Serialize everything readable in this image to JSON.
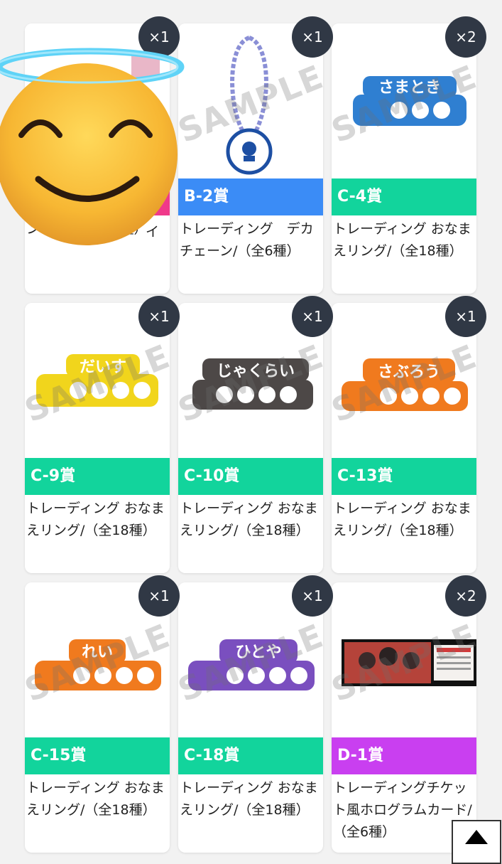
{
  "cards": [
    {
      "grade": "",
      "grade_color": "#f0398a",
      "quantity": "×1",
      "description": "ンボード/（全6種）",
      "obscured_title_fragment": "イ",
      "image": "pink-item-obscured"
    },
    {
      "grade": "B-2賞",
      "grade_color": "#3b8cf6",
      "quantity": "×1",
      "description": "トレーディング　デカチェーン/（全6種）",
      "image": "chain-skull-keyholder"
    },
    {
      "grade": "C-4賞",
      "grade_color": "#12d49c",
      "quantity": "×2",
      "description": "トレーディング おなまえリング/（全18種）",
      "image": "name-ring-blue",
      "ring_text": "さまとき"
    },
    {
      "grade": "C-9賞",
      "grade_color": "#12d49c",
      "quantity": "×1",
      "description": "トレーディング おなまえリング/（全18種）",
      "image": "name-ring-yellow",
      "ring_text": "だいす"
    },
    {
      "grade": "C-10賞",
      "grade_color": "#12d49c",
      "quantity": "×1",
      "description": "トレーディング おなまえリング/（全18種）",
      "image": "name-ring-gray",
      "ring_text": "じゃくらい"
    },
    {
      "grade": "C-13賞",
      "grade_color": "#12d49c",
      "quantity": "×1",
      "description": "トレーディング おなまえリング/（全18種）",
      "image": "name-ring-orange",
      "ring_text": "さぶろう"
    },
    {
      "grade": "C-15賞",
      "grade_color": "#12d49c",
      "quantity": "×1",
      "description": "トレーディング おなまえリング/（全18種）",
      "image": "name-ring-orange",
      "ring_text": "れい"
    },
    {
      "grade": "C-18賞",
      "grade_color": "#12d49c",
      "quantity": "×1",
      "description": "トレーディング おなまえリング/（全18種）",
      "image": "name-ring-purple",
      "ring_text": "ひとや"
    },
    {
      "grade": "D-1賞",
      "grade_color": "#c93ff0",
      "quantity": "×2",
      "description": "トレーディングチケット風ホログラムカード/（全6種）",
      "image": "hologram-ticket-card"
    }
  ],
  "watermark": "SAMPLE",
  "overlay": {
    "icon": "smiling-face-with-halo-emoji"
  },
  "scroll_top": {
    "icon": "triangle-up-icon"
  }
}
